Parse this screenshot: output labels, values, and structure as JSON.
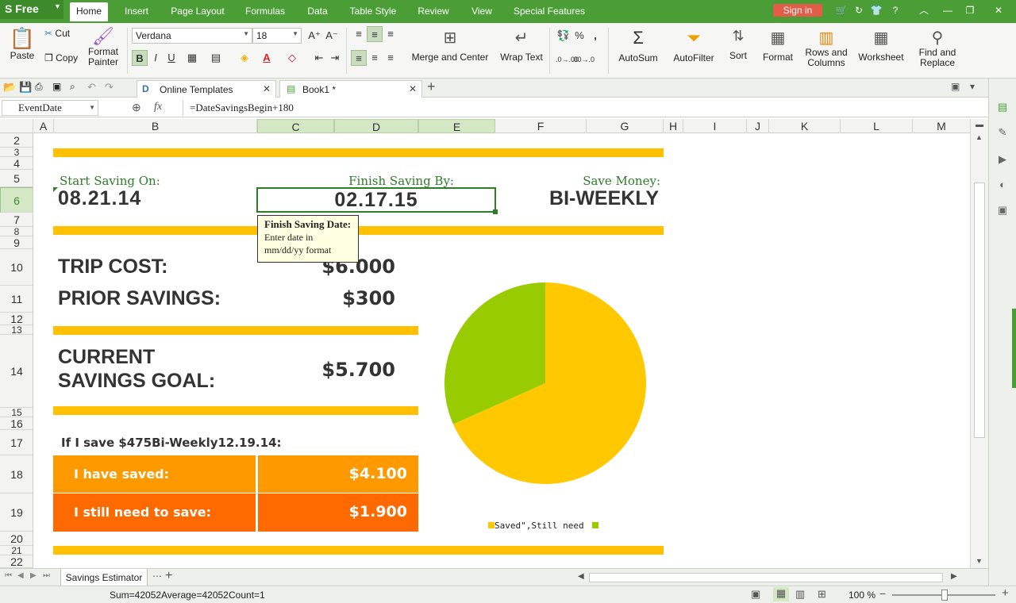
{
  "app": {
    "logo": "Free",
    "menu": [
      "Home",
      "Insert",
      "Page Layout",
      "Formulas",
      "Data",
      "Table Style",
      "Review",
      "View",
      "Special Features"
    ],
    "sign_in": "Sign in"
  },
  "ribbon": {
    "paste": "Paste",
    "cut": "Cut",
    "copy": "Copy",
    "format_painter": [
      "Format",
      "Painter"
    ],
    "font_name": "Verdana",
    "font_size": "18",
    "bold": "B",
    "italic": "I",
    "underline": "U",
    "merge_center": "Merge and Center",
    "wrap_text": "Wrap Text",
    "percent": "%",
    "comma": ",",
    "autosum": "AutoSum",
    "autofilter": "AutoFilter",
    "sort": "Sort",
    "format": "Format",
    "rows_columns": [
      "Rows and",
      "Columns"
    ],
    "worksheet": "Worksheet",
    "find_replace": [
      "Find and",
      "Replace"
    ]
  },
  "tabs": {
    "online_templates": "Online Templates",
    "book": "Book1 *"
  },
  "formula_bar": {
    "name_box": "EventDate",
    "fx": "fx",
    "formula": "=DateSavingsBegin+180"
  },
  "columns": [
    "A",
    "B",
    "C",
    "D",
    "E",
    "F",
    "G",
    "H",
    "I",
    "J",
    "K",
    "L",
    "M"
  ],
  "rows": [
    "2",
    "3",
    "4",
    "5",
    "6",
    "7",
    "8",
    "9",
    "10",
    "11",
    "12",
    "13",
    "14",
    "15",
    "16",
    "17",
    "18",
    "19",
    "20",
    "21",
    "22"
  ],
  "sheet": {
    "start_label": "Start Saving On:",
    "start_date": "08.21.14",
    "finish_label": "Finish Saving By:",
    "finish_date": "02.17.15",
    "save_label": "Save Money:",
    "save_freq": "BI-WEEKLY",
    "trip_cost_label": "TRIP COST:",
    "trip_cost": "$6.000",
    "prior_label": "PRIOR SAVINGS:",
    "prior": "$300",
    "goal_label_1": "CURRENT",
    "goal_label_2": "SAVINGS GOAL:",
    "goal": "$5.700",
    "if_i_save": "If I save $475Bi-Weekly12.19.14:",
    "saved_label": "I have saved:",
    "saved": "$4.100",
    "need_label": "I still need to save:",
    "need": "$1.900"
  },
  "tooltip": {
    "title": "Finish Saving Date:",
    "line1": "Enter date in",
    "line2": "mm/dd/yy format"
  },
  "chart_data": {
    "type": "pie",
    "categories": [
      "Saved\"",
      "Still need"
    ],
    "values": [
      4100,
      1900
    ],
    "colors": [
      "#ffc800",
      "#99cc00"
    ],
    "legend": "bottom",
    "legend_text": "Saved\",Still need"
  },
  "sheet_tab": "Savings Estimator",
  "status": {
    "sum": "Sum=42052",
    "average": "Average=42052",
    "count": "Count=1",
    "zoom": "100 %"
  }
}
